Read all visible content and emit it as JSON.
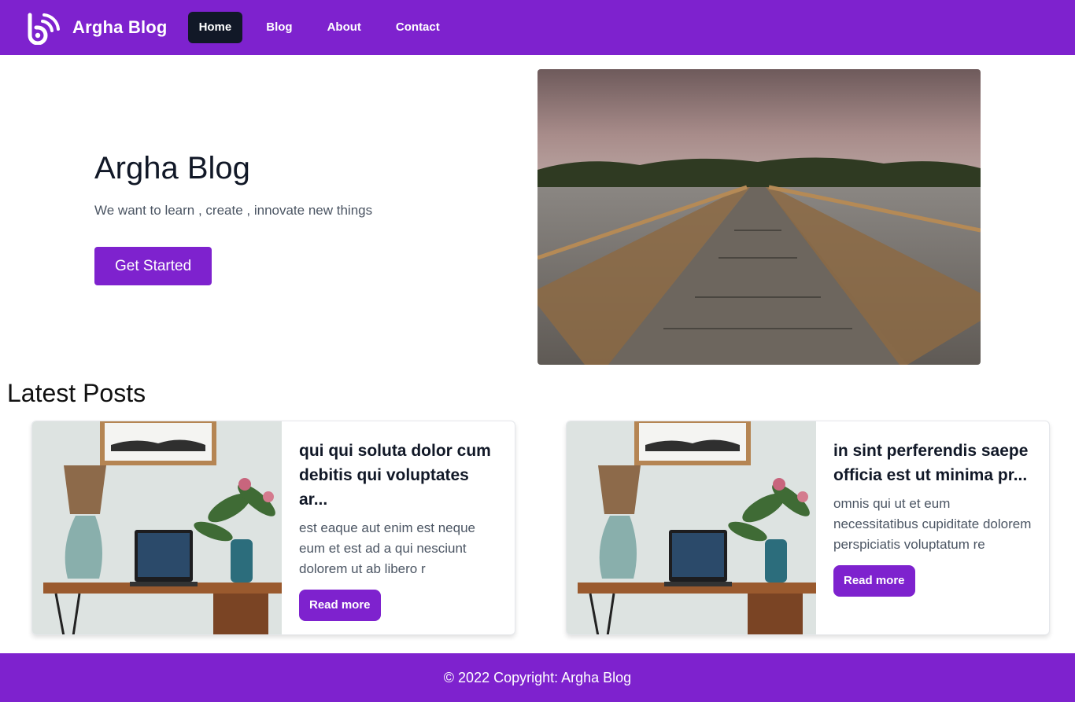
{
  "navbar": {
    "logo_icon": "rss-b-logo-icon",
    "brand": "Argha Blog",
    "links": [
      {
        "label": "Home",
        "active": true
      },
      {
        "label": "Blog",
        "active": false
      },
      {
        "label": "About",
        "active": false
      },
      {
        "label": "Contact",
        "active": false
      }
    ]
  },
  "hero": {
    "title": "Argha Blog",
    "subtitle": "We want to learn , create , innovate new things",
    "cta": "Get Started"
  },
  "latest": {
    "heading": "Latest Posts",
    "posts": [
      {
        "title": "qui qui soluta dolor cum debitis qui voluptates ar...",
        "body": "est eaque aut enim est neque eum et est ad a qui nesciunt dolorem ut ab libero r",
        "button": "Read more"
      },
      {
        "title": "in sint perferendis saepe officia est ut minima pr...",
        "body": "omnis qui ut et eum necessitatibus cupiditate dolorem perspiciatis voluptatum re",
        "button": "Read more"
      }
    ]
  },
  "footer": {
    "text": "© 2022 Copyright: Argha Blog"
  },
  "colors": {
    "brand_purple": "#7e22ce",
    "active_nav": "#111827"
  }
}
